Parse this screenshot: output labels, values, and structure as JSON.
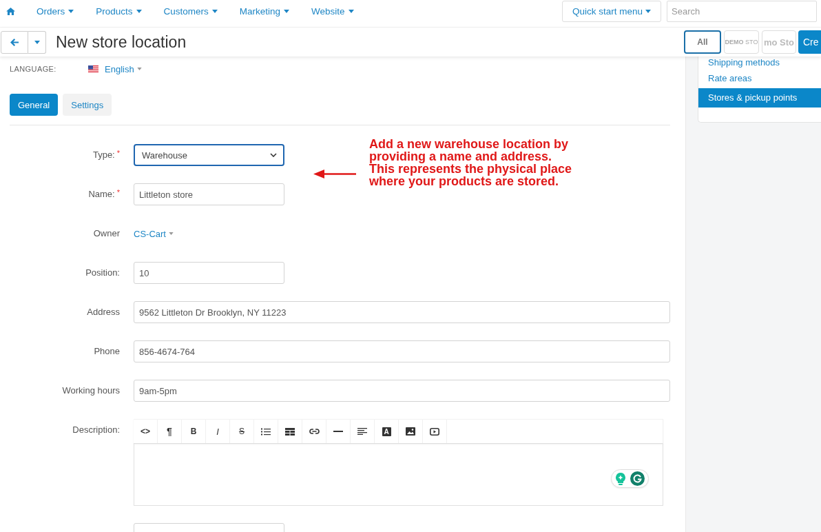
{
  "top_nav": {
    "menus": [
      {
        "label": "Orders"
      },
      {
        "label": "Products"
      },
      {
        "label": "Customers"
      },
      {
        "label": "Marketing"
      },
      {
        "label": "Website"
      }
    ],
    "quick_start": {
      "label": "Quick start menu"
    },
    "search": {
      "placeholder": "Search"
    }
  },
  "page_header": {
    "title": "New store location",
    "storefronts": [
      {
        "kind": "text",
        "label": "All",
        "selected": true
      },
      {
        "kind": "logo",
        "label": "**DEMO** STO",
        "selected": false
      },
      {
        "kind": "logo",
        "label": "**mo Sto**",
        "selected": false
      }
    ],
    "create_button": {
      "label": "Cre"
    }
  },
  "sidebar": {
    "items": [
      {
        "label": "Shipping methods",
        "selected": false
      },
      {
        "label": "Rate areas",
        "selected": false
      },
      {
        "label": "Stores & pickup points",
        "selected": true
      }
    ]
  },
  "language": {
    "label": "LANGUAGE:",
    "value": "English"
  },
  "tabs": [
    {
      "label": "General",
      "selected": true
    },
    {
      "label": "Settings",
      "selected": false
    }
  ],
  "form": {
    "required_mark": "*",
    "fields": [
      {
        "kind": "select",
        "label": "Type:",
        "required": true,
        "focused": true,
        "value": "Warehouse"
      },
      {
        "kind": "input",
        "label": "Name:",
        "required": true,
        "focused": false,
        "value": "Littleton store"
      },
      {
        "kind": "menu",
        "label": "Owner",
        "required": false,
        "focused": false,
        "value": "CS-Cart"
      },
      {
        "kind": "input",
        "label": "Position:",
        "required": false,
        "focused": false,
        "value": "10"
      },
      {
        "kind": "wide",
        "label": "Address",
        "required": false,
        "focused": false,
        "value": "9562 Littleton Dr Brooklyn, NY 11223"
      },
      {
        "kind": "wide",
        "label": "Phone",
        "required": false,
        "focused": false,
        "value": "856-4674-764"
      },
      {
        "kind": "wide",
        "label": "Working hours",
        "required": false,
        "focused": false,
        "value": "9am-5pm"
      },
      {
        "kind": "editor",
        "label": "Description:",
        "required": false,
        "focused": false,
        "toolbar": [
          {
            "kind": "code",
            "label": "<>"
          },
          {
            "kind": "paragraph",
            "label": "¶"
          },
          {
            "kind": "bold",
            "label": "B"
          },
          {
            "kind": "italic",
            "label": "I"
          },
          {
            "kind": "strike",
            "label": "S"
          },
          {
            "kind": "list"
          },
          {
            "kind": "table"
          },
          {
            "kind": "link"
          },
          {
            "kind": "rule"
          },
          {
            "kind": "align"
          },
          {
            "kind": "color",
            "label": "A"
          },
          {
            "kind": "image"
          },
          {
            "kind": "video"
          }
        ]
      },
      {
        "kind": "select",
        "required": false,
        "focused": false
      }
    ]
  },
  "annotation": {
    "text": "Add a new warehouse location by\nproviding a name and address.\nThis represents the physical place\nwhere your products are stored."
  }
}
